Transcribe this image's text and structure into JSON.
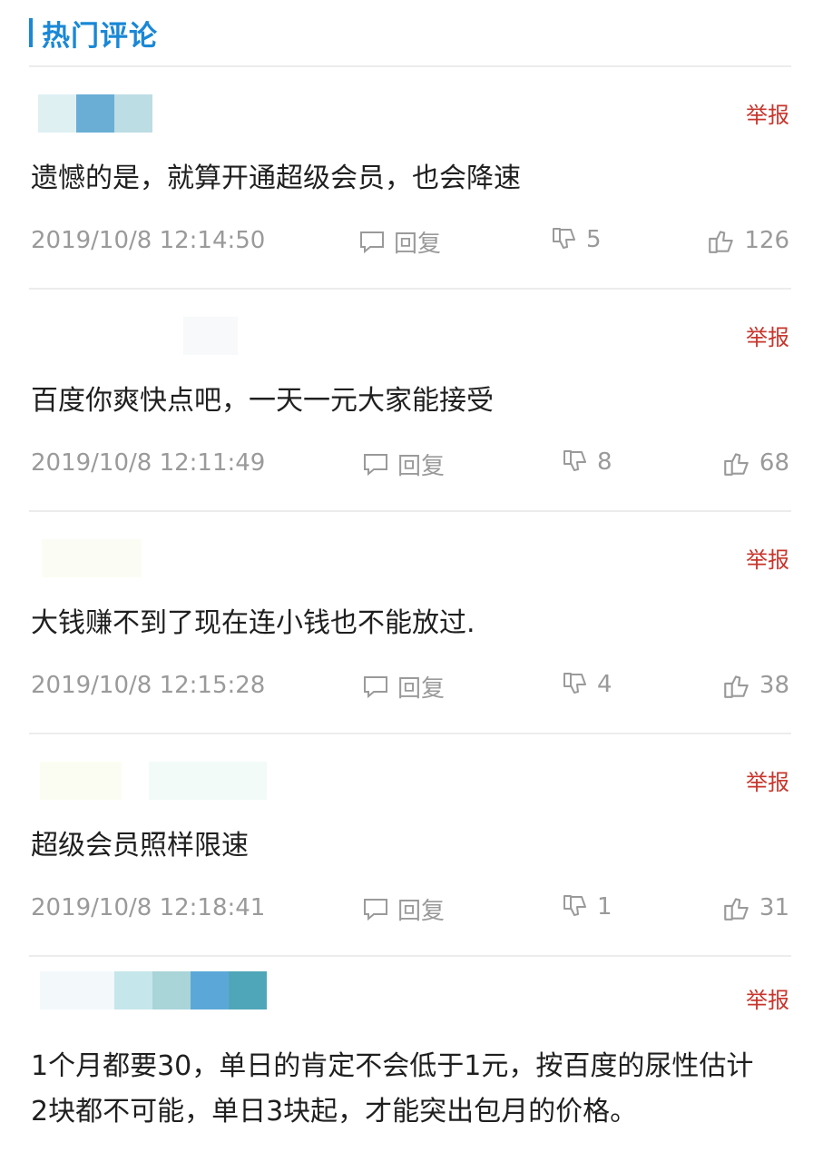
{
  "header": {
    "title": "热门评论",
    "accent_color": "#1a88d6"
  },
  "comments": [
    {
      "report_label": "举报",
      "text": "遗憾的是，就算开通超级会员，也会降速",
      "time": "2019/10/8 12:14:50",
      "reply_label": "回复",
      "dislikes": "5",
      "likes": "126"
    },
    {
      "report_label": "举报",
      "text": "百度你爽快点吧，一天一元大家能接受",
      "time": "2019/10/8 12:11:49",
      "reply_label": "回复",
      "dislikes": "8",
      "likes": "68"
    },
    {
      "report_label": "举报",
      "text": "大钱赚不到了现在连小钱也不能放过.",
      "time": "2019/10/8 12:15:28",
      "reply_label": "回复",
      "dislikes": "4",
      "likes": "38"
    },
    {
      "report_label": "举报",
      "text": "超级会员照样限速",
      "time": "2019/10/8 12:18:41",
      "reply_label": "回复",
      "dislikes": "1",
      "likes": "31"
    },
    {
      "report_label": "举报",
      "text_line1": "1个月都要30，单日的肯定不会低于1元，按百度的尿性估计",
      "text_line2": "2块都不可能，单日3块起，才能突出包月的价格。"
    }
  ],
  "icons": {
    "reply": "comment-icon",
    "dislike": "thumbs-down-icon",
    "like": "thumbs-up-icon"
  },
  "colors": {
    "report": "#c8352c",
    "meta": "#9a9a9a",
    "divider": "#ececec"
  }
}
